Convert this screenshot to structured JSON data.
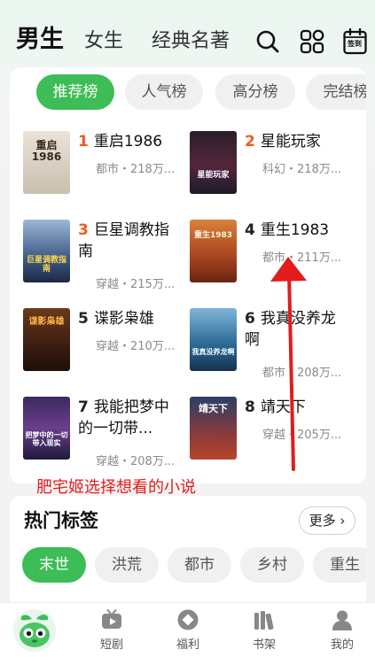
{
  "top_tabs": [
    "男生",
    "女生",
    "经典名著"
  ],
  "top_icons": {
    "search": "search-icon",
    "apps": "grid-icon",
    "sign": "calendar-sign-icon",
    "sign_label": "签到"
  },
  "rank_chips": [
    "推荐榜",
    "人气榜",
    "高分榜",
    "完结榜"
  ],
  "books": [
    {
      "rank": "1",
      "title": "重启1986",
      "meta": "都市・218万...",
      "cover_text": "重启1986"
    },
    {
      "rank": "2",
      "title": "星能玩家",
      "meta": "科幻・218万...",
      "cover_text": "星能玩家"
    },
    {
      "rank": "3",
      "title": "巨星调教指南",
      "meta": "穿越・215万...",
      "cover_text": "巨星调教指南"
    },
    {
      "rank": "4",
      "title": "重生1983",
      "meta": "都市・211万...",
      "cover_text": "重生1983"
    },
    {
      "rank": "5",
      "title": "谍影枭雄",
      "meta": "穿越・210万...",
      "cover_text": "谍影枭雄"
    },
    {
      "rank": "6",
      "title": "我真没养龙啊",
      "meta": "都市・208万...",
      "cover_text": "我真没养龙啊"
    },
    {
      "rank": "7",
      "title": "我能把梦中的一切带...",
      "meta": "穿越・208万...",
      "cover_text": "把梦中的一切带入现实"
    },
    {
      "rank": "8",
      "title": "靖天下",
      "meta": "穿越・205万...",
      "cover_text": "靖天下"
    }
  ],
  "annotation": "肥宅姬选择想看的小说",
  "hot_tags": {
    "title": "热门标签",
    "more": "更多",
    "tags": [
      "末世",
      "洪荒",
      "都市",
      "乡村",
      "重生"
    ]
  },
  "bottom_nav": [
    "短剧",
    "福利",
    "书架",
    "我的"
  ],
  "colors": {
    "accent": "#3dbd55",
    "rank_top": "#f25a1b",
    "annotation": "#e21c1c"
  }
}
